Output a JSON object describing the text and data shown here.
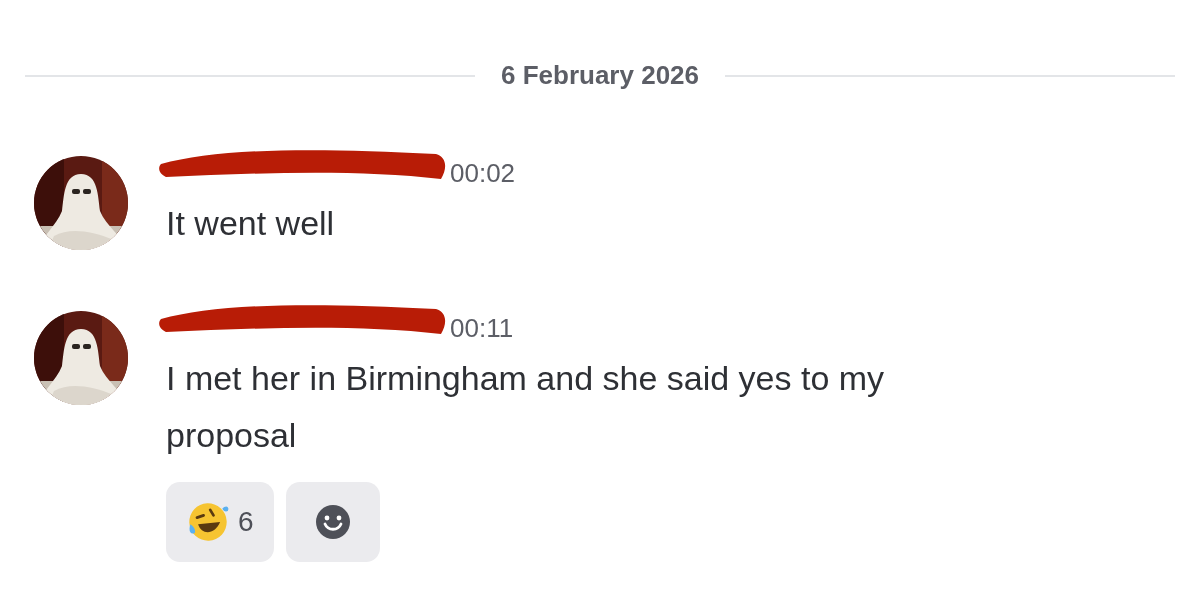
{
  "date_divider": "6 February 2026",
  "messages": [
    {
      "time": "00:02",
      "text": "It went well"
    },
    {
      "time": "00:11",
      "text": "I met her in Birmingham and she said yes to my proposal",
      "reactions": [
        {
          "count": "6"
        }
      ]
    }
  ]
}
